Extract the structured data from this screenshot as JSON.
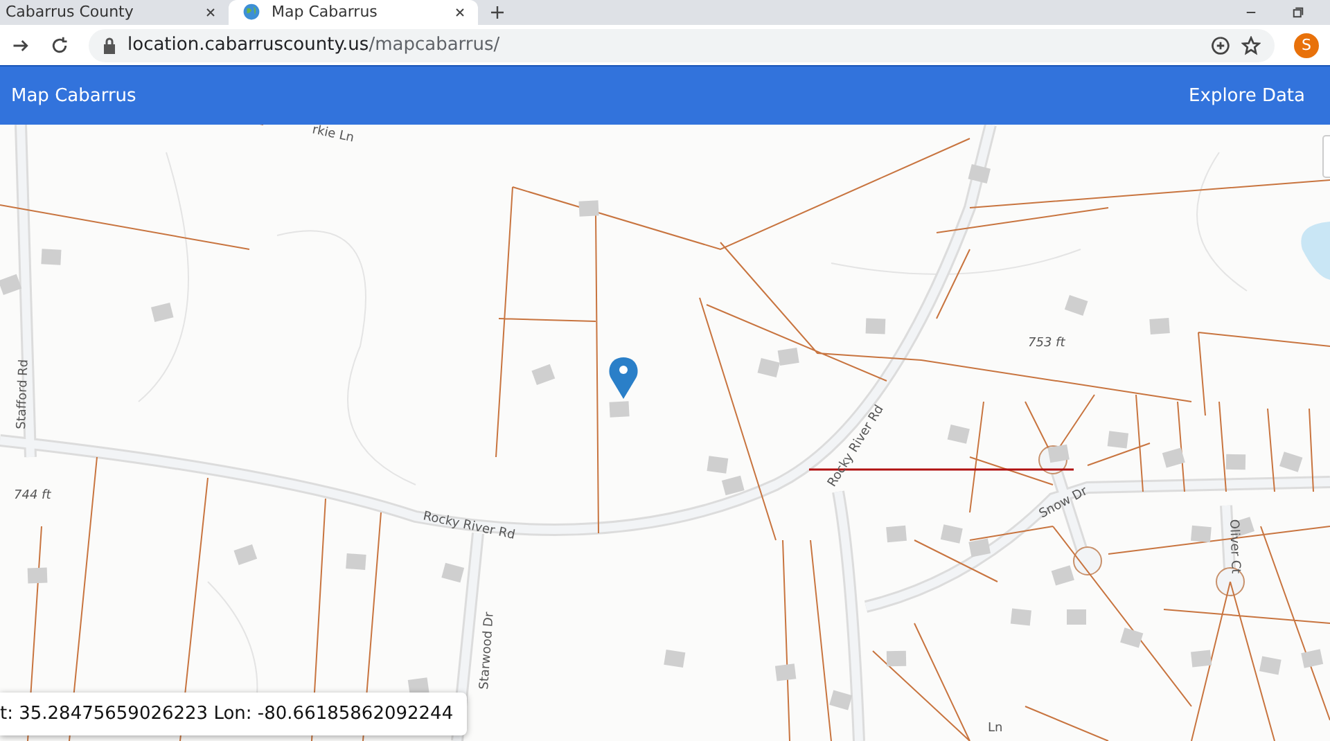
{
  "browser": {
    "tabs": [
      {
        "title": "Cabarrus County",
        "selected": false
      },
      {
        "title": "Map Cabarrus",
        "selected": true
      }
    ],
    "url": {
      "host": "location.cabarruscounty.us",
      "path": "/mapcabarrus/"
    },
    "profile_initial": "S"
  },
  "app_bar": {
    "title": "Map Cabarrus",
    "link": "Explore Data"
  },
  "map": {
    "labels": [
      {
        "kind": "street",
        "text": "rkie Ln"
      },
      {
        "kind": "street",
        "text": "Stafford Rd"
      },
      {
        "kind": "street",
        "text": "Rocky River Rd"
      },
      {
        "kind": "street",
        "text": "Rocky River Rd"
      },
      {
        "kind": "street",
        "text": "Starwood Dr"
      },
      {
        "kind": "street",
        "text": "Snow Dr"
      },
      {
        "kind": "street",
        "text": "Oliver Ct"
      },
      {
        "kind": "street",
        "text": "Ln"
      },
      {
        "kind": "elevation",
        "text": "744 ft"
      },
      {
        "kind": "elevation",
        "text": "753 ft"
      }
    ]
  },
  "coordinates": "t: 35.28475659026223 Lon: -80.66185862092244"
}
